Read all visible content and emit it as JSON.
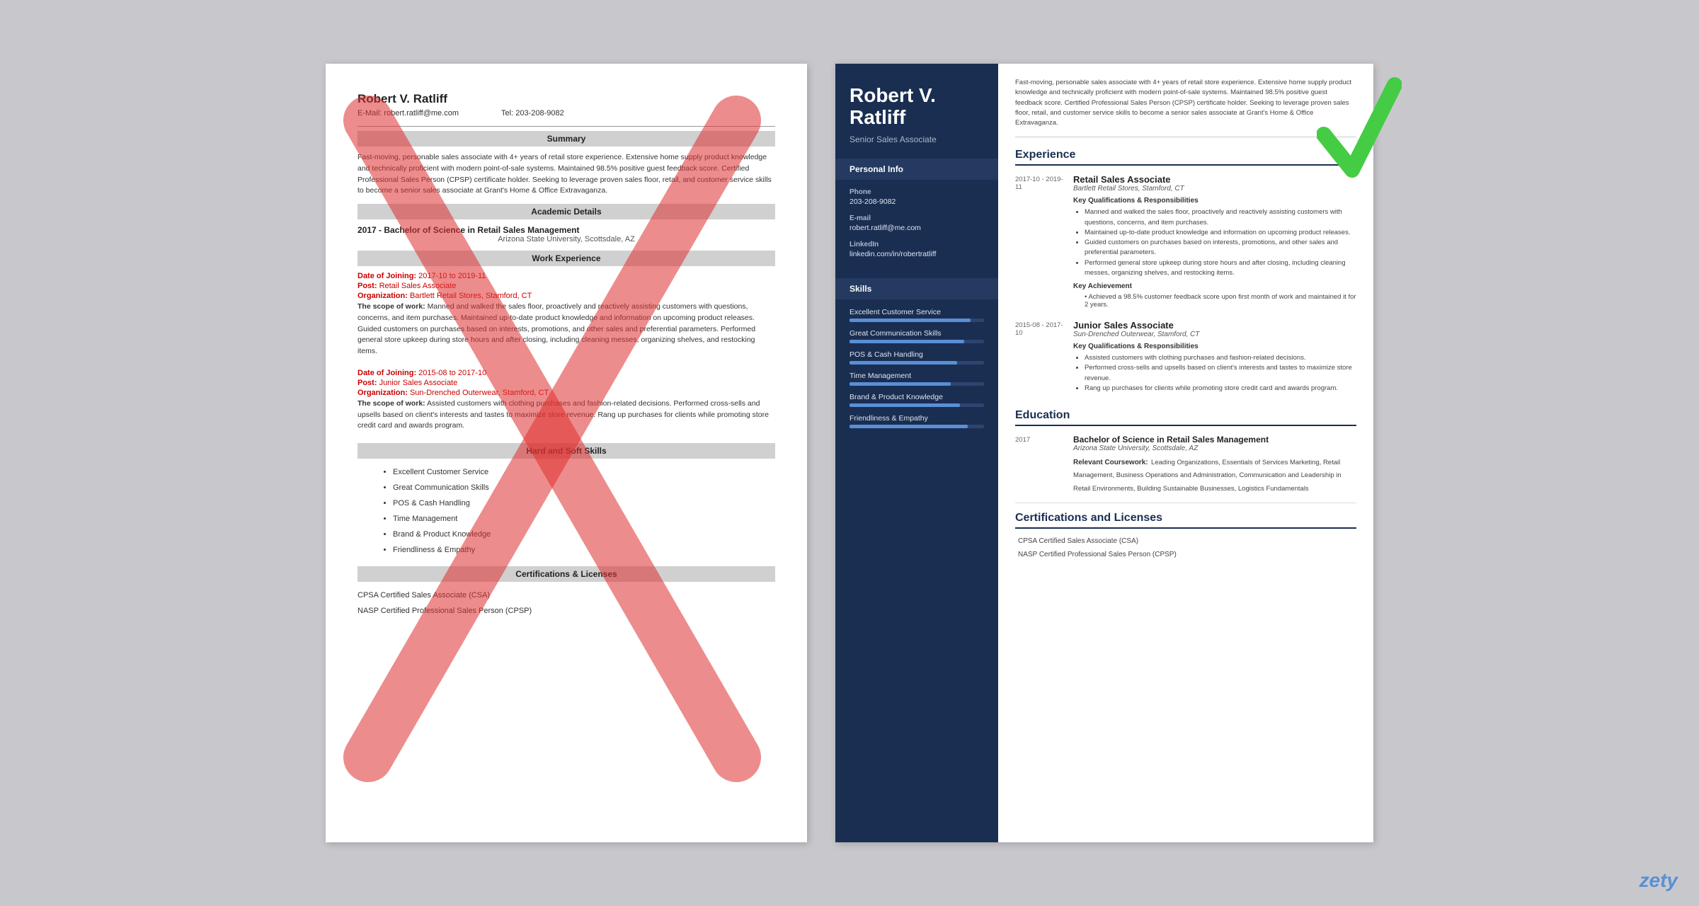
{
  "page": {
    "background_color": "#c8c8cc"
  },
  "left_resume": {
    "name": "Robert V. Ratliff",
    "email_label": "E-Mail:",
    "email": "robert.ratliff@me.com",
    "tel_label": "Tel:",
    "phone": "203-208-9082",
    "sections": {
      "summary": {
        "title": "Summary",
        "text": "Fast-moving, personable sales associate with 4+ years of retail store experience. Extensive home supply product knowledge and technically proficient with modern point-of-sale systems. Maintained 98.5% positive guest feedback score. Certified Professional Sales Person (CPSP) certificate holder. Seeking to leverage proven sales floor, retail, and customer service skills to become a senior sales associate at Grant's Home & Office Extravaganza."
      },
      "academic": {
        "title": "Academic Details",
        "year": "2017 -",
        "degree": "Bachelor of Science in Retail Sales Management",
        "school": "Arizona State University, Scottsdale, AZ"
      },
      "work_experience": {
        "title": "Work Experience",
        "entries": [
          {
            "date_label": "Date of Joining:",
            "date": "2017-10 to 2019-11",
            "post_label": "Post:",
            "post": "Retail Sales Associate",
            "org_label": "Organization:",
            "org": "Bartlett Retail Stores, Stamford, CT",
            "scope_label": "The scope of work:",
            "scope": "Manned and walked the sales floor, proactively and reactively assisting customers with questions, concerns, and item purchases. Maintained up-to-date product knowledge and information on upcoming product releases. Guided customers on purchases based on interests, promotions, and other sales and preferential parameters. Performed general store upkeep during store hours and after closing, including cleaning messes, organizing shelves, and restocking items."
          },
          {
            "date_label": "Date of Joining:",
            "date": "2015-08 to 2017-10",
            "post_label": "Post:",
            "post": "Junior Sales Associate",
            "org_label": "Organization:",
            "org": "Sun-Drenched Outerwear, Stamford, CT",
            "scope_label": "The scope of work:",
            "scope": "Assisted customers with clothing purchases and fashion-related decisions. Performed cross-sells and upsells based on client's interests and tastes to maximize store revenue. Rang up purchases for clients while promoting store credit card and awards program."
          }
        ]
      },
      "skills": {
        "title": "Hard and Soft Skills",
        "items": [
          "Excellent Customer Service",
          "Great Communication Skills",
          "POS & Cash Handling",
          "Time Management",
          "Brand & Product Knowledge",
          "Friendliness & Empathy"
        ]
      },
      "certifications": {
        "title": "Certifications & Licenses",
        "items": [
          "CPSA Certified Sales Associate (CSA)",
          "NASP Certified Professional Sales Person (CPSP)"
        ]
      }
    }
  },
  "right_resume": {
    "name_line1": "Robert V.",
    "name_line2": "Ratliff",
    "title": "Senior Sales Associate",
    "summary": "Fast-moving, personable sales associate with 4+ years of retail store experience. Extensive home supply product knowledge and technically proficient with modern point-of-sale systems. Maintained 98.5% positive guest feedback score. Certified Professional Sales Person (CPSP) certificate holder. Seeking to leverage proven sales floor, retail, and customer service skills to become a senior sales associate at Grant's Home & Office Extravaganza.",
    "personal_info": {
      "section_title": "Personal Info",
      "phone_label": "Phone",
      "phone": "203-208-9082",
      "email_label": "E-mail",
      "email": "robert.ratliff@me.com",
      "linkedin_label": "LinkedIn",
      "linkedin": "linkedin.com/in/robertratliff"
    },
    "skills": {
      "section_title": "Skills",
      "items": [
        {
          "name": "Excellent Customer Service",
          "pct": 90
        },
        {
          "name": "Great Communication Skills",
          "pct": 85
        },
        {
          "name": "POS & Cash Handling",
          "pct": 80
        },
        {
          "name": "Time Management",
          "pct": 75
        },
        {
          "name": "Brand & Product Knowledge",
          "pct": 82
        },
        {
          "name": "Friendliness & Empathy",
          "pct": 88
        }
      ]
    },
    "experience": {
      "section_title": "Experience",
      "entries": [
        {
          "date": "2017-10 - 2019-11",
          "job_title": "Retail Sales Associate",
          "company": "Bartlett Retail Stores, Stamford, CT",
          "qualifications_title": "Key Qualifications & Responsibilities",
          "bullets": [
            "Manned and walked the sales floor, proactively and reactively assisting customers with questions, concerns, and item purchases.",
            "Maintained up-to-date product knowledge and information on upcoming product releases.",
            "Guided customers on purchases based on interests, promotions, and other sales and preferential parameters.",
            "Performed general store upkeep during store hours and after closing, including cleaning messes, organizing shelves, and restocking items."
          ],
          "achievement_title": "Key Achievement",
          "achievement": "Achieved a 98.5% customer feedback score upon first month of work and maintained it for 2 years."
        },
        {
          "date": "2015-08 - 2017-10",
          "job_title": "Junior Sales Associate",
          "company": "Sun-Drenched Outerwear, Stamford, CT",
          "qualifications_title": "Key Qualifications & Responsibilities",
          "bullets": [
            "Assisted customers with clothing purchases and fashion-related decisions.",
            "Performed cross-sells and upsells based on client's interests and tastes to maximize store revenue.",
            "Rang up purchases for clients while promoting store credit card and awards program."
          ]
        }
      ]
    },
    "education": {
      "section_title": "Education",
      "entries": [
        {
          "year": "2017",
          "degree": "Bachelor of Science in Retail Sales Management",
          "school": "Arizona State University, Scottsdale, AZ",
          "coursework_label": "Relevant Coursework:",
          "coursework": "Leading Organizations, Essentials of Services Marketing, Retail Management, Business Operations and Administration, Communication and Leadership in Retail Environments, Building Sustainable Businesses, Logistics Fundamentals"
        }
      ]
    },
    "certifications": {
      "section_title": "Certifications and Licenses",
      "items": [
        "CPSA Certified Sales Associate (CSA)",
        "NASP Certified Professional Sales Person (CPSP)"
      ]
    }
  },
  "watermark": "zety"
}
